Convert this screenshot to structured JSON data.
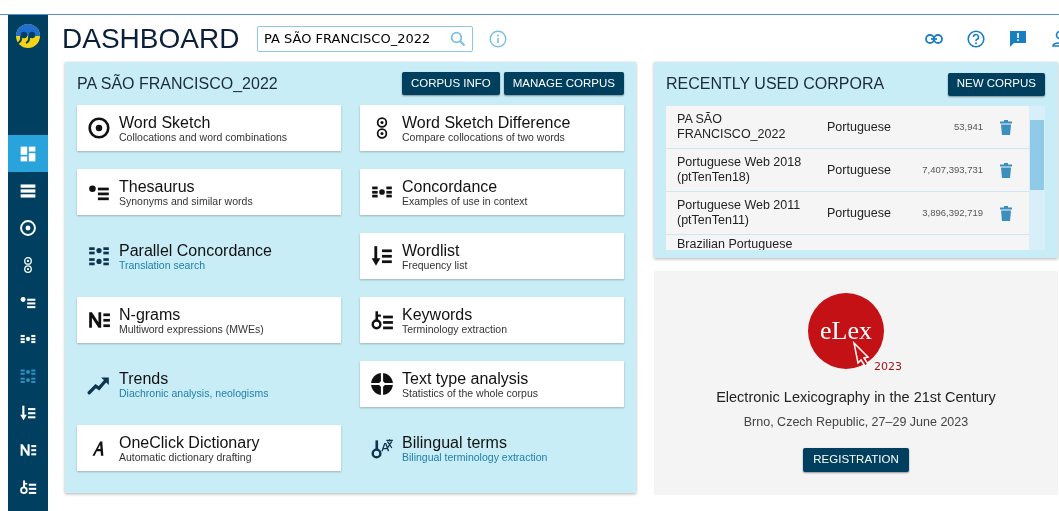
{
  "header": {
    "title": "DASHBOARD",
    "search": {
      "value": "PA SÃO FRANCISCO_2022"
    }
  },
  "sidebar": {
    "items": [
      {
        "selected": true,
        "disabled": false
      },
      {
        "selected": false,
        "disabled": false
      },
      {
        "selected": false,
        "disabled": false
      },
      {
        "selected": false,
        "disabled": false
      },
      {
        "selected": false,
        "disabled": false
      },
      {
        "selected": false,
        "disabled": false
      },
      {
        "selected": false,
        "disabled": true
      },
      {
        "selected": false,
        "disabled": false
      },
      {
        "selected": false,
        "disabled": false
      },
      {
        "selected": false,
        "disabled": false
      }
    ]
  },
  "corpus_panel": {
    "title": "PA SÃO FRANCISCO_2022",
    "buttons": [
      "CORPUS INFO",
      "MANAGE CORPUS"
    ],
    "tools": [
      {
        "title": "Word Sketch",
        "subtitle": "Collocations and word combinations",
        "available": true
      },
      {
        "title": "Word Sketch Difference",
        "subtitle": "Compare collocations of two words",
        "available": true
      },
      {
        "title": "Thesaurus",
        "subtitle": "Synonyms and similar words",
        "available": true
      },
      {
        "title": "Concordance",
        "subtitle": "Examples of use in context",
        "available": true
      },
      {
        "title": "Parallel Concordance",
        "subtitle": "Translation search",
        "available": false
      },
      {
        "title": "Wordlist",
        "subtitle": "Frequency list",
        "available": true
      },
      {
        "title": "N-grams",
        "subtitle": "Multiword expressions (MWEs)",
        "available": true
      },
      {
        "title": "Keywords",
        "subtitle": "Terminology extraction",
        "available": true
      },
      {
        "title": "Trends",
        "subtitle": "Diachronic analysis, neologisms",
        "available": false
      },
      {
        "title": "Text type analysis",
        "subtitle": "Statistics of the whole corpus",
        "available": true
      },
      {
        "title": "OneClick Dictionary",
        "subtitle": "Automatic dictionary drafting",
        "available": true
      },
      {
        "title": "Bilingual terms",
        "subtitle": "Bilingual terminology extraction",
        "available": false
      }
    ]
  },
  "recent_corpora": {
    "title": "RECENTLY USED CORPORA",
    "button": "NEW CORPUS",
    "rows": [
      {
        "name": "PA SÃO FRANCISCO_2022",
        "language": "Portuguese",
        "size": "53,941"
      },
      {
        "name": "Portuguese Web 2018 (ptTenTen18)",
        "language": "Portuguese",
        "size": "7,407,393,731"
      },
      {
        "name": "Portuguese Web 2011 (ptTenTen11)",
        "language": "Portuguese",
        "size": "3,896,392,719"
      },
      {
        "name": "Brazilian Portuguese"
      }
    ]
  },
  "banner": {
    "logo_text": "eLex",
    "logo_year": "2023",
    "title": "Electronic Lexicography in the 21st Century",
    "subtitle": "Brno, Czech Republic, 27–29 June 2023",
    "button": "REGISTRATION"
  }
}
